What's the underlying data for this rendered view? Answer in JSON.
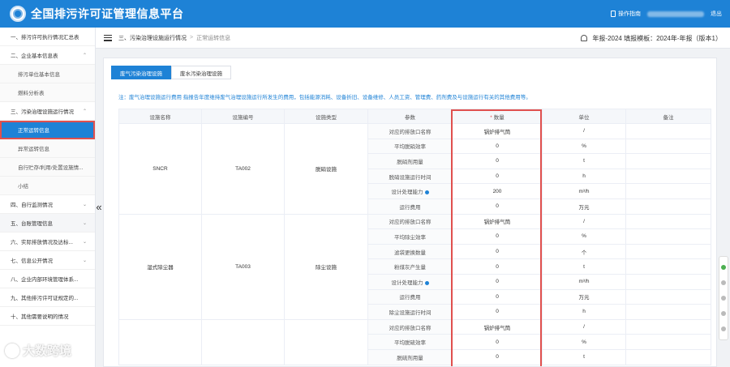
{
  "app": {
    "title": "全国排污许可证管理信息平台"
  },
  "topbar": {
    "manual_label": "操作指南",
    "logout_label": "退出"
  },
  "sidebar": {
    "items": [
      {
        "label": "一、排污许可执行情况汇总表",
        "caret": ""
      },
      {
        "label": "二、企业基本信息表",
        "caret": "⌃"
      },
      {
        "label": "排污单位基本信息",
        "caret": ""
      },
      {
        "label": "燃料分析表",
        "caret": ""
      },
      {
        "label": "三、污染治理设施运行情况",
        "caret": "⌃"
      },
      {
        "label": "正常运转信息",
        "caret": ""
      },
      {
        "label": "异常运转信息",
        "caret": ""
      },
      {
        "label": "自行贮存/利用/处置设施情...",
        "caret": ""
      },
      {
        "label": "小结",
        "caret": ""
      },
      {
        "label": "四、自行监测情况",
        "caret": "⌄"
      },
      {
        "label": "五、台账管理信息",
        "caret": "⌄"
      },
      {
        "label": "六、实际排放情况及达标...",
        "caret": "⌄"
      },
      {
        "label": "七、信息公开情况",
        "caret": "⌄"
      },
      {
        "label": "八、企业内部环境管理体系...",
        "caret": ""
      },
      {
        "label": "九、其他排污许可证规定的...",
        "caret": ""
      },
      {
        "label": "十、其他需要说明的情况",
        "caret": ""
      }
    ],
    "collapse_glyph": "«"
  },
  "breadcrumb": {
    "parent": "三、污染治理设施运行情况",
    "separator": ">",
    "current": "正常运转信息",
    "report_info": "年报-2024  填报模板：2024年-年报（版本1）"
  },
  "tabs": [
    {
      "label": "废气污染治理设施"
    },
    {
      "label": "废水污染治理设施"
    }
  ],
  "note": "注：废气治理设施运行费用 指报告年度维持废气治理设施运行所发生的费用，包括能源消耗、设备折旧、设备维修、人员工资、管理费、药剂费及与设施运行有关的其他费用等。",
  "table": {
    "headers": [
      "设施名称",
      "设施编号",
      "设施类型",
      "参数",
      "数量",
      "单位",
      "备注"
    ],
    "required_mark": "*",
    "groups": [
      {
        "name": "SNCR",
        "code": "TA002",
        "type": "脱硝设施",
        "rows": [
          {
            "param": "对应的排放口名称",
            "value": "锅炉排气筒",
            "unit": "/",
            "info": false
          },
          {
            "param": "平均脱硝效率",
            "value": "0",
            "unit": "%",
            "info": false
          },
          {
            "param": "脱硝剂用量",
            "value": "0",
            "unit": "t",
            "info": false
          },
          {
            "param": "脱硝设施运行时间",
            "value": "0",
            "unit": "h",
            "info": false
          },
          {
            "param": "设计处理能力",
            "value": "200",
            "unit": "m³/h",
            "info": true
          },
          {
            "param": "运行费用",
            "value": "0",
            "unit": "万元",
            "info": false
          }
        ]
      },
      {
        "name": "湿式除尘器",
        "code": "TA003",
        "type": "除尘设施",
        "rows": [
          {
            "param": "对应的排放口名称",
            "value": "锅炉排气筒",
            "unit": "/",
            "info": false
          },
          {
            "param": "平均除尘效率",
            "value": "0",
            "unit": "%",
            "info": false
          },
          {
            "param": "滤袋更换数量",
            "value": "0",
            "unit": "个",
            "info": false
          },
          {
            "param": "粉煤灰产生量",
            "value": "0",
            "unit": "t",
            "info": false
          },
          {
            "param": "设计处理能力",
            "value": "0",
            "unit": "m³/h",
            "info": true
          },
          {
            "param": "运行费用",
            "value": "0",
            "unit": "万元",
            "info": false
          },
          {
            "param": "除尘设施运行时间",
            "value": "0",
            "unit": "h",
            "info": false
          }
        ]
      },
      {
        "name": "",
        "code": "",
        "type": "",
        "rows": [
          {
            "param": "对应的排放口名称",
            "value": "锅炉排气筒",
            "unit": "/",
            "info": false
          },
          {
            "param": "平均脱硫效率",
            "value": "0",
            "unit": "%",
            "info": false
          },
          {
            "param": "脱硫剂用量",
            "value": "0",
            "unit": "t",
            "info": false
          }
        ]
      }
    ]
  },
  "watermark": "大数跨境"
}
